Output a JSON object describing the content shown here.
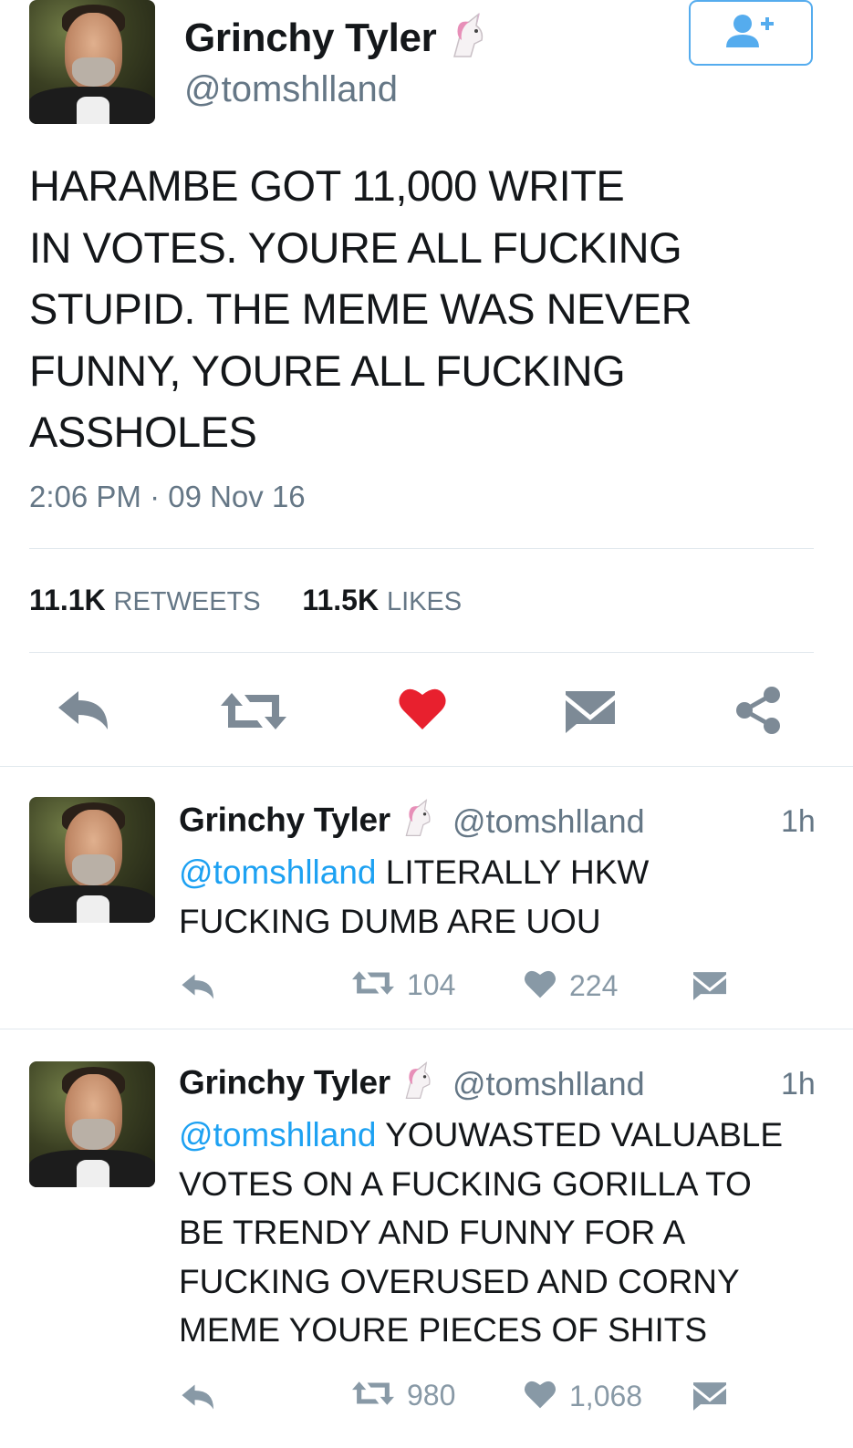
{
  "main_tweet": {
    "author_name": "Grinchy Tyler",
    "handle": "@tomshlland",
    "text": "HARAMBE GOT 11,000 WRITE\nIN VOTES. YOURE ALL FUCKING\nSTUPID. THE MEME WAS NEVER\nFUNNY, YOURE ALL FUCKING\nASSHOLES",
    "timestamp": "2:06 PM · 09 Nov 16",
    "retweets_count": "11.1K",
    "retweets_label": "RETWEETS",
    "likes_count": "11.5K",
    "likes_label": "LIKES",
    "liked": true
  },
  "icons": {
    "follow": "add-user-icon",
    "reply": "reply-icon",
    "retweet": "retweet-icon",
    "like": "heart-icon",
    "dm": "envelope-icon",
    "share": "share-icon",
    "badge": "unicorn-icon"
  },
  "colors": {
    "accent": "#1da1f2",
    "follow_border": "#55acee",
    "like_red": "#e8202e",
    "muted": "#657786",
    "icon_gray": "#7d8a96"
  },
  "replies": [
    {
      "author_name": "Grinchy Tyler",
      "handle": "@tomshlland",
      "time_ago": "1h",
      "mention": "@tomshlland",
      "text": " LITERALLY HKW\nFUCKING DUMB ARE UOU",
      "retweets": "104",
      "likes": "224"
    },
    {
      "author_name": "Grinchy Tyler",
      "handle": "@tomshlland",
      "time_ago": "1h",
      "mention": "@tomshlland",
      "text": " YOUWASTED VALUABLE\nVOTES ON A FUCKING GORILLA TO\nBE TRENDY AND FUNNY FOR A\nFUCKING OVERUSED AND CORNY\nMEME YOURE PIECES OF SHITS",
      "retweets": "980",
      "likes": "1,068"
    }
  ]
}
